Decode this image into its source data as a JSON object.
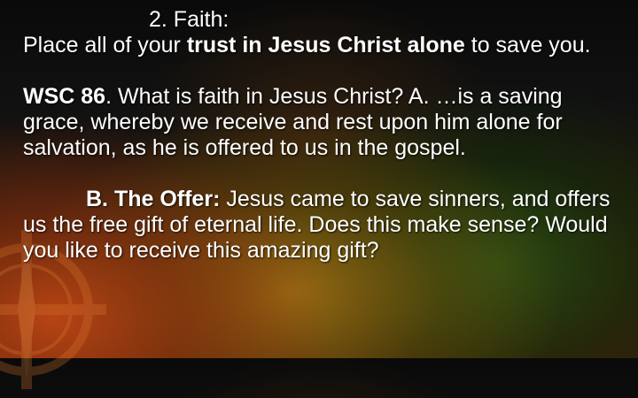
{
  "heading": "2. Faith:",
  "faith": {
    "pre": "Place all of your ",
    "bold": "trust in Jesus Christ alone",
    "post": " to save you."
  },
  "wsc": {
    "bold": "WSC 86",
    "rest": ". What is faith in Jesus Christ? A. …is a saving grace, whereby we receive and rest upon him alone for salvation, as he is offered to us in the gospel."
  },
  "offer": {
    "bold": "B. The Offer:",
    "rest": " Jesus came to save sinners, and offers us the free gift of eternal life. Does this make sense?  Would you like to receive this amazing gift?"
  },
  "emblem_icon": "compass-cross-icon"
}
